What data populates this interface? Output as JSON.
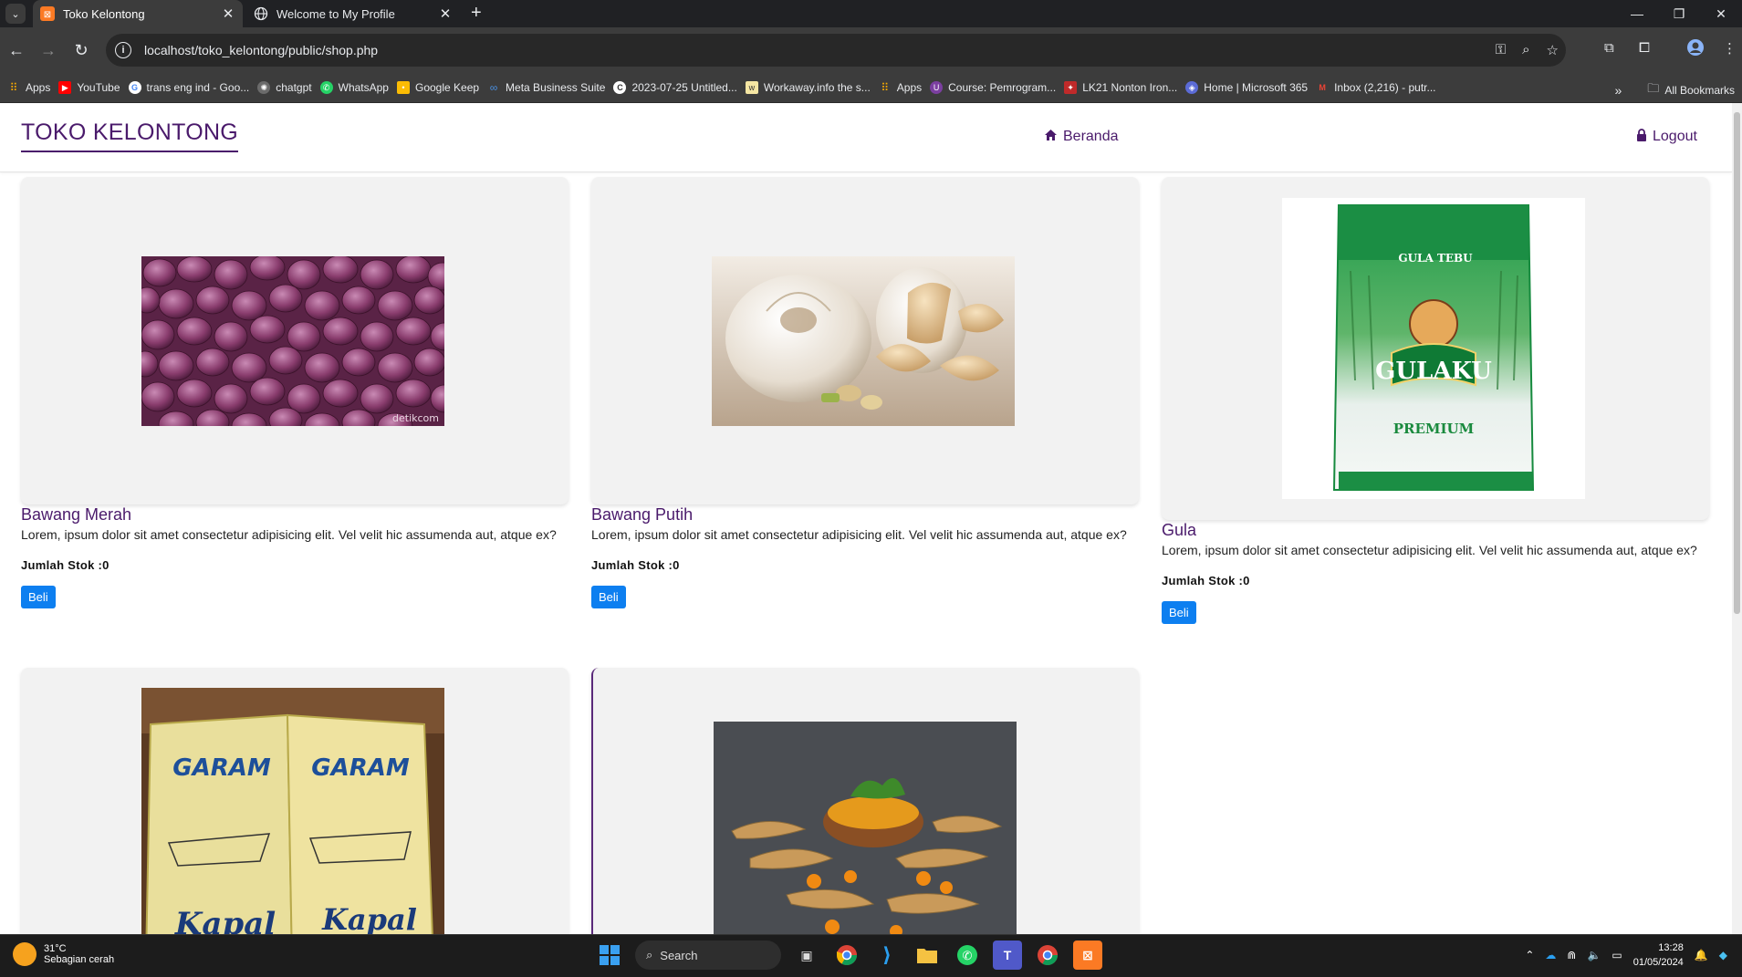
{
  "browser": {
    "tabs": [
      {
        "title": "Toko Kelontong",
        "active": true
      },
      {
        "title": "Welcome to My Profile",
        "active": false
      }
    ],
    "url": "localhost/toko_kelontong/public/shop.php",
    "bookmarks": [
      "Apps",
      "YouTube",
      "trans eng ind - Goo...",
      "chatgpt",
      "WhatsApp",
      "Google Keep",
      "Meta Business Suite",
      "2023-07-25 Untitled...",
      "Workaway.info the s...",
      "Apps",
      "Course: Pemrogram...",
      "LK21 Nonton Iron...",
      "Home | Microsoft 365",
      "Inbox (2,216) - putr..."
    ],
    "all_bookmarks": "All Bookmarks",
    "bookmark_more": "»"
  },
  "site": {
    "brand": "TOKO KELONTONG",
    "nav": {
      "home": "Beranda",
      "logout": "Logout"
    }
  },
  "products": [
    {
      "name": "Bawang Merah",
      "desc": "Lorem, ipsum dolor sit amet consectetur adipisicing elit. Vel velit hic assumenda aut, atque ex?",
      "stock": "Jumlah Stok :0",
      "button": "Beli"
    },
    {
      "name": "Bawang Putih",
      "desc": "Lorem, ipsum dolor sit amet consectetur adipisicing elit. Vel velit hic assumenda aut, atque ex?",
      "stock": "Jumlah Stok :0",
      "button": "Beli"
    },
    {
      "name": "Gula",
      "desc": "Lorem, ipsum dolor sit amet consectetur adipisicing elit. Vel velit hic assumenda aut, atque ex?",
      "stock": "Jumlah Stok :0",
      "button": "Beli"
    },
    {
      "image_label": "GARAM"
    },
    {
      "image_label": ""
    }
  ],
  "image_text": {
    "gula_brand": "GULAKU",
    "gula_top": "GULA TEBU",
    "gula_premium": "PREMIUM",
    "garam_brand": "GARAM",
    "garam_sub": "Kapal",
    "watermark": "detikcom"
  },
  "taskbar": {
    "weather_temp": "31°C",
    "weather_desc": "Sebagian cerah",
    "search": "Search",
    "time": "13:28",
    "date": "01/05/2024"
  }
}
